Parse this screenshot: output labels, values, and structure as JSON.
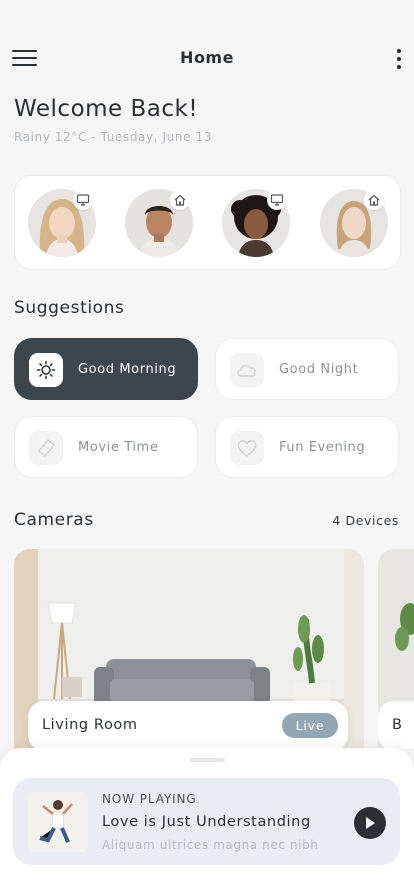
{
  "header": {
    "title": "Home"
  },
  "welcome": {
    "heading": "Welcome Back!",
    "weather": "Rainy 12°C - Tuesday, June 13"
  },
  "members": [
    {
      "badge_icon": "monitor-icon"
    },
    {
      "badge_icon": "home-icon"
    },
    {
      "badge_icon": "monitor-icon"
    },
    {
      "badge_icon": "home-icon"
    }
  ],
  "suggestions": {
    "title": "Suggestions",
    "items": [
      {
        "label": "Good Morning",
        "icon": "sun-icon",
        "active": true
      },
      {
        "label": "Good Night",
        "icon": "cloud-icon",
        "active": false
      },
      {
        "label": "Movie Time",
        "icon": "ticket-icon",
        "active": false
      },
      {
        "label": "Fun Evening",
        "icon": "heart-icon",
        "active": false
      }
    ]
  },
  "cameras": {
    "title": "Cameras",
    "count": "4 Devices",
    "items": [
      {
        "name": "Living Room",
        "status": "Live"
      },
      {
        "name": "B"
      }
    ]
  },
  "now_playing": {
    "label": "NOW PLAYING",
    "track": "Love is Just Understanding",
    "subtitle": "Aliquam ultrices magna nec nibh"
  },
  "colors": {
    "dark": "#3d454d",
    "live_badge": "#93a6b6",
    "player_bg": "#e9edf3"
  }
}
